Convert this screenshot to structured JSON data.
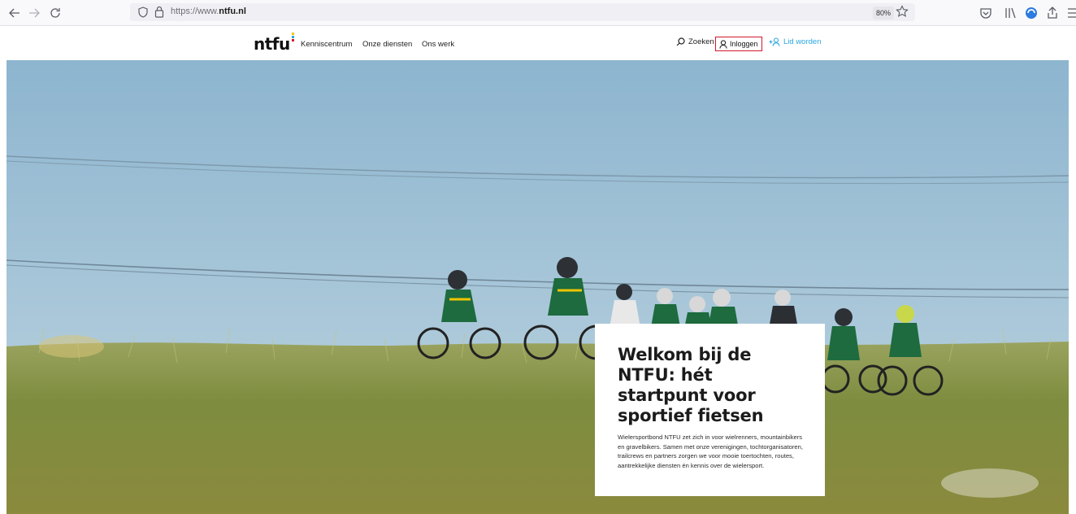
{
  "browser": {
    "url_prefix": "https://www.",
    "url_domain": "ntfu.nl",
    "zoom": "80%"
  },
  "site": {
    "logo": "ntfu",
    "nav": [
      "Kenniscentrum",
      "Onze diensten",
      "Ons werk"
    ],
    "search_label": "Zoeken",
    "login_label": "Inloggen",
    "join_label": "Lid worden"
  },
  "hero": {
    "title": "Welkom bij de NTFU: hét startpunt voor sportief fietsen",
    "body": "Wielersportbond NTFU zet zich in voor wielrenners, mountainbikers en gravelbikers. Samen met onze verenigingen, tochtorganisatoren, trailcrews en partners zorgen we voor mooie toertochten, routes, aantrekkelijke diensten én kennis over de wielersport."
  },
  "colors": {
    "accent_blue": "#2aa6e0",
    "login_border": "#d0192b"
  }
}
